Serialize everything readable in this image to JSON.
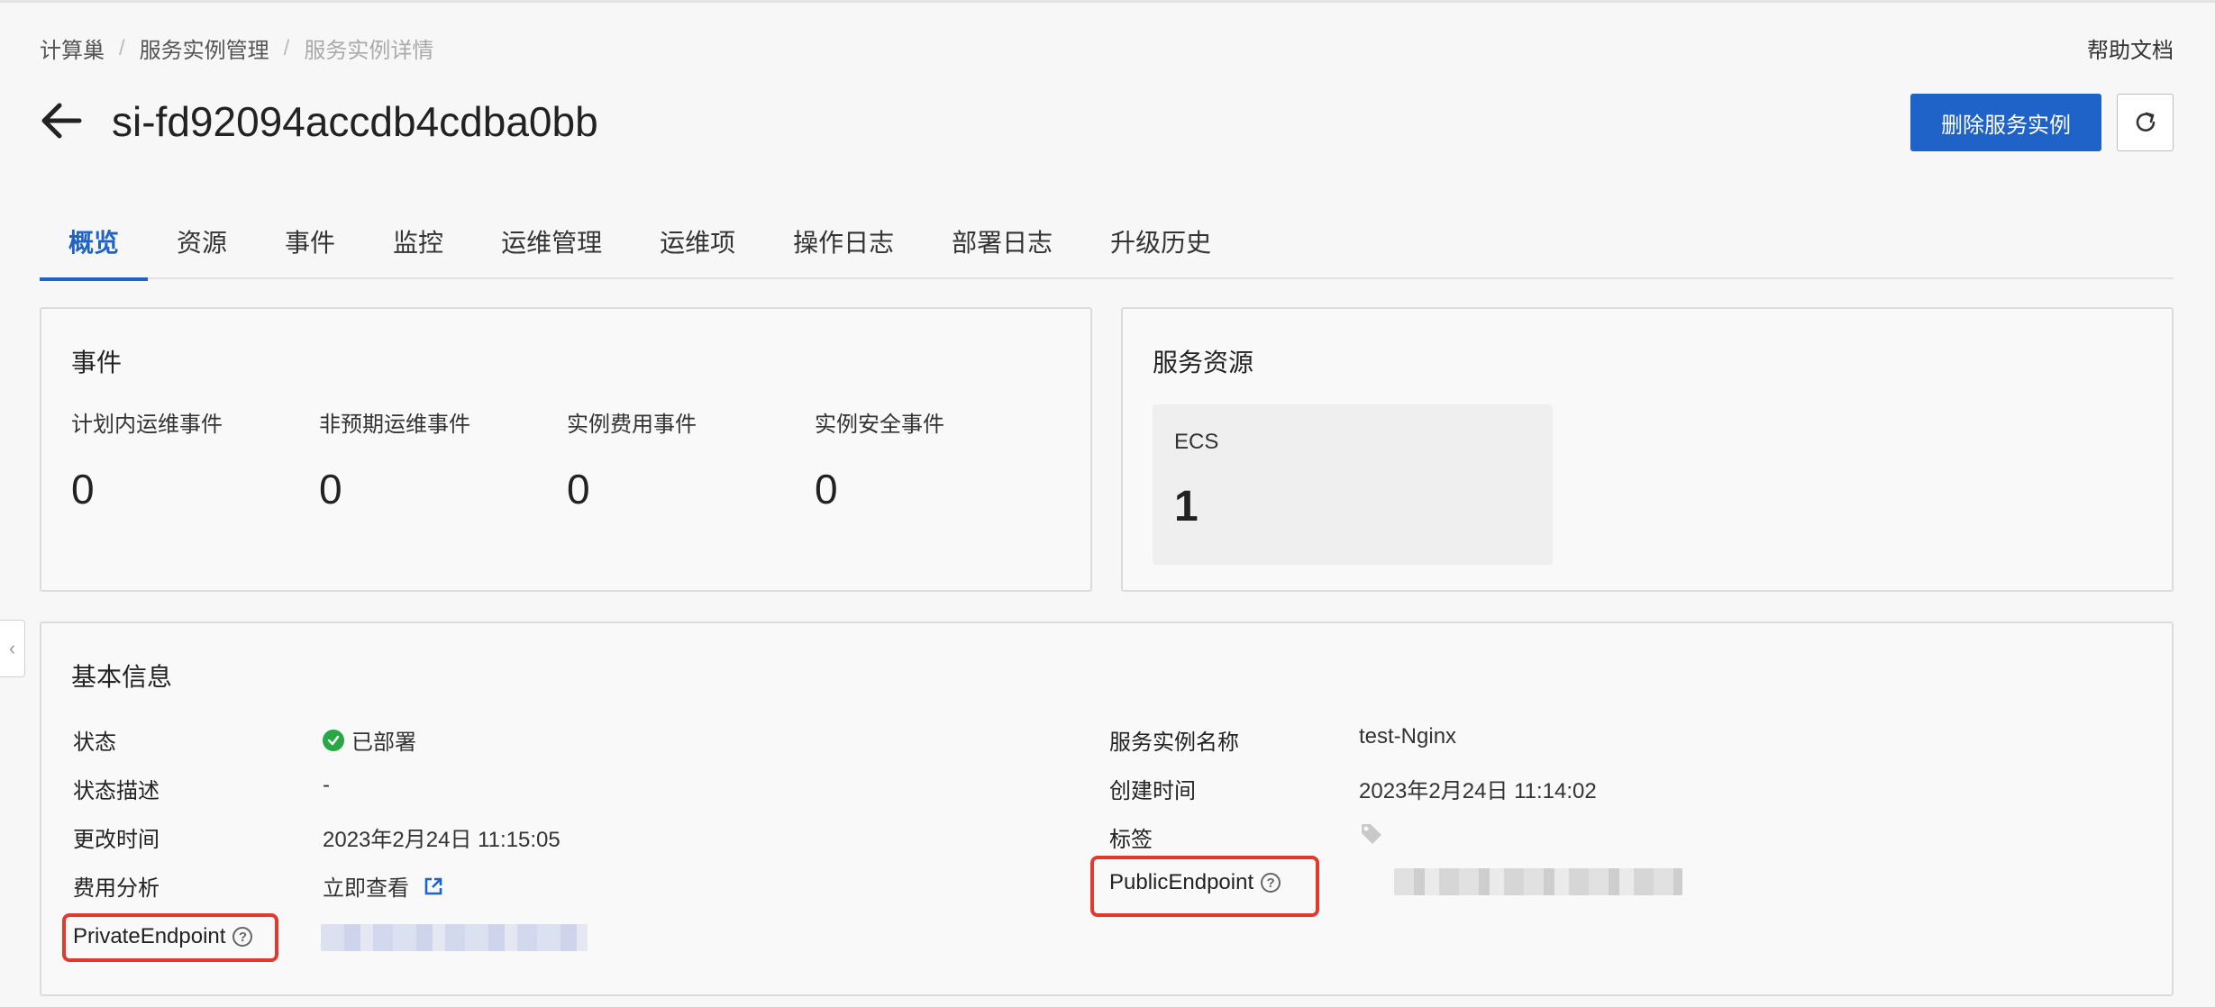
{
  "breadcrumb": [
    "计算巢",
    "服务实例管理",
    "服务实例详情"
  ],
  "help_link": "帮助文档",
  "title": "si-fd92094accdb4cdba0bb",
  "buttons": {
    "delete": "删除服务实例"
  },
  "tabs": [
    "概览",
    "资源",
    "事件",
    "监控",
    "运维管理",
    "运维项",
    "操作日志",
    "部署日志",
    "升级历史"
  ],
  "active_tab": "概览",
  "events": {
    "title": "事件",
    "items": [
      {
        "label": "计划内运维事件",
        "value": "0"
      },
      {
        "label": "非预期运维事件",
        "value": "0"
      },
      {
        "label": "实例费用事件",
        "value": "0"
      },
      {
        "label": "实例安全事件",
        "value": "0"
      }
    ]
  },
  "resources": {
    "title": "服务资源",
    "ecs": {
      "label": "ECS",
      "value": "1"
    }
  },
  "basic": {
    "title": "基本信息",
    "status_label": "状态",
    "status_value": "已部署",
    "status_desc_label": "状态描述",
    "status_desc_value": "-",
    "modified_label": "更改时间",
    "modified_value": "2023年2月24日 11:15:05",
    "cost_label": "费用分析",
    "cost_link": "立即查看",
    "private_endpoint_label": "PrivateEndpoint",
    "name_label": "服务实例名称",
    "name_value": "test-Nginx",
    "created_label": "创建时间",
    "created_value": "2023年2月24日 11:14:02",
    "tags_label": "标签",
    "public_endpoint_label": "PublicEndpoint"
  },
  "colors": {
    "accent": "#1f63c9",
    "success": "#28a745",
    "highlight": "#e3382e"
  }
}
